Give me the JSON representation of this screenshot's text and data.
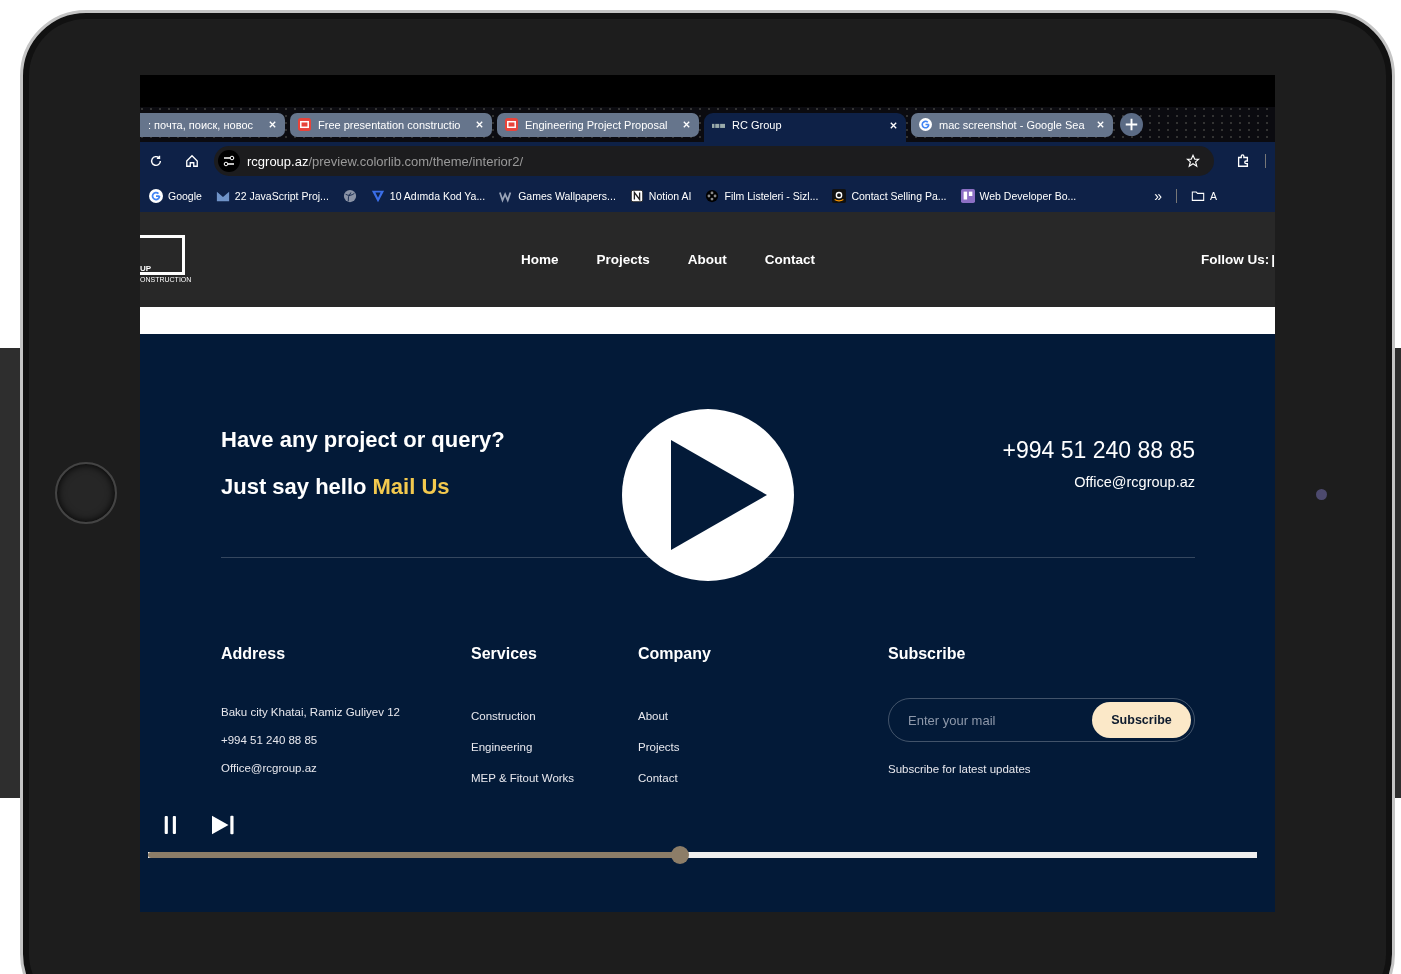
{
  "browser": {
    "tabs": [
      {
        "title": ": почта, поиск, новос",
        "kind": "plain",
        "selected": false
      },
      {
        "title": "Free presentation constructio",
        "kind": "app",
        "selected": false
      },
      {
        "title": "Engineering Project Proposal",
        "kind": "app",
        "selected": false
      },
      {
        "title": "RC Group",
        "kind": "site",
        "selected": true
      },
      {
        "title": "mac screenshot - Google Sea",
        "kind": "google",
        "selected": false
      }
    ],
    "address": {
      "domain": "rcgroup.az",
      "path": "/preview.colorlib.com/theme/interior2/"
    },
    "bookmarks": [
      {
        "label": "Google",
        "kind": "google"
      },
      {
        "label": "22 JavaScript Proj...",
        "kind": "mail"
      },
      {
        "kind": "globe"
      },
      {
        "label": "10 Adımda Kod Ya...",
        "kind": "vee"
      },
      {
        "label": "Games Wallpapers...",
        "kind": "wm"
      },
      {
        "label": "Notion AI",
        "kind": "notion"
      },
      {
        "label": "Film Listeleri - Sizl...",
        "kind": "film"
      },
      {
        "label": "Contact Selling Pa...",
        "kind": "amazon"
      },
      {
        "label": "Web Developer Bo...",
        "kind": "board"
      }
    ],
    "bookmarks_overflow": "»",
    "folder_label": "A"
  },
  "site_header": {
    "logo_lines": [
      "UP",
      "ONSTRUCTION"
    ],
    "nav": [
      "Home",
      "Projects",
      "About",
      "Contact"
    ],
    "follow": "Follow Us:",
    "follow_divider": "|"
  },
  "contact": {
    "headline": "Have any project or query?",
    "hello": "Just say hello",
    "mail_link": "Mail Us",
    "phone": "+994 51 240 88 85",
    "email": "Office@rcgroup.az"
  },
  "columns": [
    {
      "heading": "Address",
      "items": [
        "Baku city Khatai, Ramiz Guliyev 12",
        "+994 51 240 88 85",
        "Office@rcgroup.az"
      ]
    },
    {
      "heading": "Services",
      "items": [
        "Construction",
        "Engineering",
        "MEP & Fitout Works"
      ]
    },
    {
      "heading": "Company",
      "items": [
        "About",
        "Projects",
        "Contact"
      ]
    }
  ],
  "subscribe": {
    "heading": "Subscribe",
    "placeholder": "Enter your mail",
    "button": "Subscribe",
    "note": "Subscribe for latest updates"
  },
  "video": {
    "playing": true,
    "level": 0.48
  }
}
